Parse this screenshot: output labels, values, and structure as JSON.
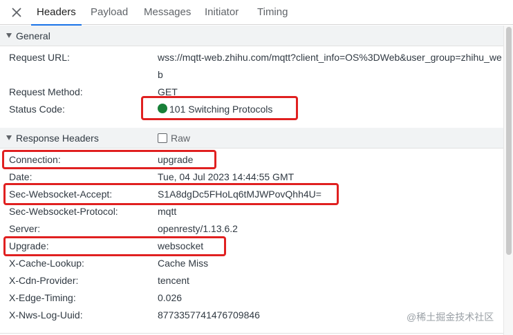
{
  "tabs": {
    "close_icon": "close-icon",
    "items": [
      {
        "label": "Headers",
        "active": true
      },
      {
        "label": "Payload",
        "active": false
      },
      {
        "label": "Messages",
        "active": false
      },
      {
        "label": "Initiator",
        "active": false
      },
      {
        "label": "Timing",
        "active": false
      }
    ]
  },
  "general": {
    "title": "General",
    "request_url_label": "Request URL:",
    "request_url_value": "wss://mqtt-web.zhihu.com/mqtt?client_info=OS%3DWeb&user_group=zhihu_web",
    "request_method_label": "Request Method:",
    "request_method_value": "GET",
    "status_code_label": "Status Code:",
    "status_code_value": "101 Switching Protocols",
    "status_color": "#188038"
  },
  "response_headers": {
    "title": "Response Headers",
    "raw_label": "Raw",
    "raw_checked": false,
    "rows": [
      {
        "key": "Connection:",
        "value": "upgrade",
        "highlighted": true
      },
      {
        "key": "Date:",
        "value": "Tue, 04 Jul 2023 14:44:55 GMT",
        "highlighted": false
      },
      {
        "key": "Sec-Websocket-Accept:",
        "value": "S1A8dgDc5FHoLq6tMJWPovQhh4U=",
        "highlighted": true
      },
      {
        "key": "Sec-Websocket-Protocol:",
        "value": "mqtt",
        "highlighted": false
      },
      {
        "key": "Server:",
        "value": "openresty/1.13.6.2",
        "highlighted": false
      },
      {
        "key": "Upgrade:",
        "value": "websocket",
        "highlighted": true
      },
      {
        "key": "X-Cache-Lookup:",
        "value": "Cache Miss",
        "highlighted": false
      },
      {
        "key": "X-Cdn-Provider:",
        "value": "tencent",
        "highlighted": false
      },
      {
        "key": "X-Edge-Timing:",
        "value": "0.026",
        "highlighted": false
      },
      {
        "key": "X-Nws-Log-Uuid:",
        "value": "8773357741476709846",
        "highlighted": false
      }
    ]
  },
  "colors": {
    "accent": "#1a73e8",
    "annotation_red": "#e02020"
  },
  "watermark": "@稀土掘金技术社区"
}
